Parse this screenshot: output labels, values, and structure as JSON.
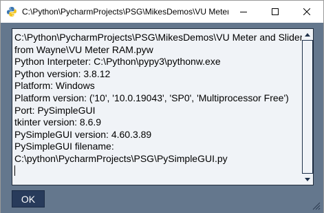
{
  "window": {
    "title": "C:\\Python\\PycharmProjects\\PSG\\MikesDemos\\VU Meter",
    "controls": {
      "minimize": "—",
      "maximize": "☐",
      "close": "✕"
    }
  },
  "output": {
    "lines": [
      "C:\\Python\\PycharmProjects\\PSG\\MikesDemos\\VU Meter and Slider",
      "from Wayne\\VU Meter RAM.pyw",
      "Python Interpeter: C:\\Python\\pypy3\\pythonw.exe",
      "Python version: 3.8.12",
      "Platform: Windows",
      "Platform version: ('10', '10.0.19043', 'SP0', 'Multiprocessor Free')",
      "Port: PySimpleGUI",
      "tkinter version: 8.6.9",
      "PySimpleGUI version: 4.60.3.89",
      "PySimpleGUI filename:",
      "C:\\python\\PycharmProjects\\PSG\\PySimpleGUI.py"
    ]
  },
  "buttons": {
    "ok": "OK"
  },
  "colors": {
    "window_bg": "#64778d",
    "text_bg": "#f0f3f7",
    "button_bg": "#283b5b",
    "scrollbar_bg": "#1d2f48"
  }
}
